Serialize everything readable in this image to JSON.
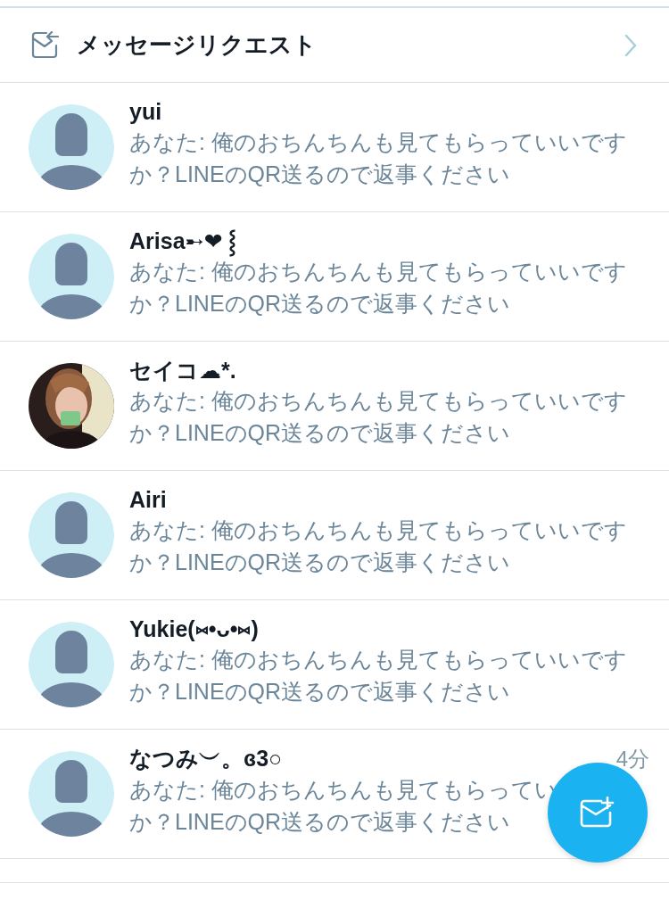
{
  "message_requests": {
    "label": "メッセージリクエスト"
  },
  "conversations": [
    {
      "name": "yui",
      "avatar": {
        "kind": "default"
      },
      "message_lines": [
        "あなた: 俺のおちんちんも見てもらっていいです",
        "か？LINEのQR送るので返事ください"
      ]
    },
    {
      "name": "Arisa➸❤ ⸾",
      "avatar": {
        "kind": "default"
      },
      "message_lines": [
        "あなた: 俺のおちんちんも見てもらっていいです",
        "か？LINEのQR送るので返事ください"
      ]
    },
    {
      "name": "セイコ☁*.",
      "message_lines": [
        "あなた: 俺のおちんちんも見てもらっていいです",
        "か？LINEのQR送るので返事ください"
      ]
    },
    {
      "name": "Airi",
      "avatar": {
        "kind": "default"
      },
      "message_lines": [
        "あなた: 俺のおちんちんも見てもらっていいです",
        "か？LINEのQR送るので返事ください"
      ]
    },
    {
      "name": "Yukie(⑅•ᴗ•⑅)",
      "avatar": {
        "kind": "default"
      },
      "message_lines": [
        "あなた: 俺のおちんちんも見てもらっていいです",
        "か？LINEのQR送るので返事ください"
      ]
    },
    {
      "name": "なつみ︶。ɞ3○",
      "time": "4分",
      "avatar": {
        "kind": "default"
      },
      "message_lines": [
        "あなた: 俺のおちんちんも見てもらってい",
        "か？LINEのQR送るので返事ください"
      ]
    }
  ]
}
